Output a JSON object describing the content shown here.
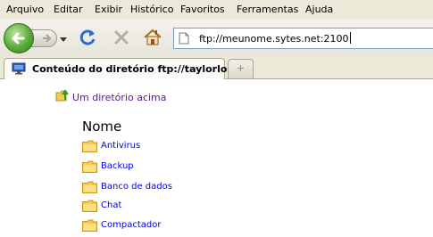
{
  "menubar": {
    "items": [
      "Arquivo",
      "Editar",
      "Exibir",
      "Histórico",
      "Favoritos",
      "Ferramentas",
      "Ajuda"
    ]
  },
  "toolbar": {
    "url": "ftp://meunome.sytes.net:2100"
  },
  "tabs": {
    "active_title": "Conteúdo do diretório ftp://taylorlo...",
    "new_tab_symbol": "+"
  },
  "page": {
    "up_directory_label": "Um diretório acima",
    "column_header": "Nome",
    "entries": [
      "Antivirus",
      "Backup",
      "Banco de dados",
      "Chat",
      "Compactador"
    ]
  },
  "colors": {
    "chrome_bg": "#ece9d8",
    "link": "#0000ee",
    "visited_link": "#551a8b",
    "folder": "#f5cd4b"
  }
}
